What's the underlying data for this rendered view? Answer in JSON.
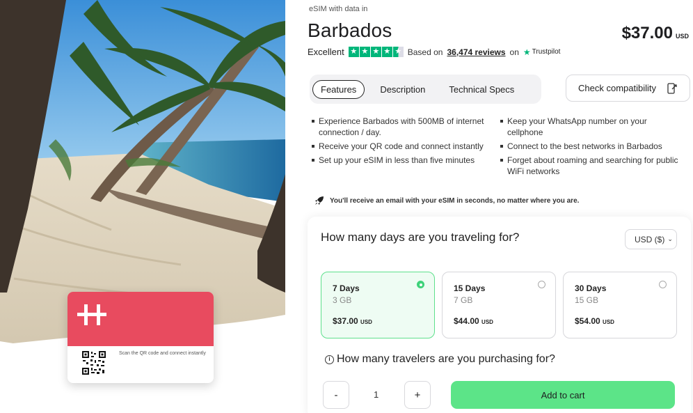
{
  "hero": {
    "card_text": "Scan the QR code and connect instantly"
  },
  "product": {
    "eyebrow": "eSIM with data in",
    "title": "Barbados",
    "price": "$37.00",
    "currency": "USD"
  },
  "rating": {
    "label": "Excellent",
    "stars": 4.5,
    "based_on": "Based on",
    "reviews_link": "36,474 reviews",
    "on": "on",
    "provider": "Trustpilot"
  },
  "tabs": [
    {
      "label": "Features",
      "active": true
    },
    {
      "label": "Description",
      "active": false
    },
    {
      "label": "Technical Specs",
      "active": false
    }
  ],
  "compat_button": "Check compatibility",
  "features": [
    "Experience Barbados with 500MB of internet connection / day.",
    "Keep your WhatsApp number on your cellphone",
    "Receive your QR code and connect instantly",
    "Connect to the best networks in Barbados",
    "Set up your eSIM in less than five minutes",
    "Forget about roaming and searching for public WiFi networks"
  ],
  "notice": "You'll receive an email with your eSIM in seconds, no matter where you are.",
  "panel": {
    "question_days": "How many days are you traveling for?",
    "currency_select": "USD ($)",
    "plans": [
      {
        "days": "7 Days",
        "data": "3 GB",
        "price": "$37.00",
        "currency": "USD",
        "selected": true
      },
      {
        "days": "15 Days",
        "data": "7 GB",
        "price": "$44.00",
        "currency": "USD",
        "selected": false
      },
      {
        "days": "30 Days",
        "data": "15 GB",
        "price": "$54.00",
        "currency": "USD",
        "selected": false
      }
    ],
    "question_travelers": "How many travelers are you purchasing for?",
    "minus": "-",
    "quantity": "1",
    "plus": "+",
    "add_to_cart": "Add to cart"
  },
  "colors": {
    "brand_red": "#e84b5f",
    "accent_green": "#5ce488",
    "trustpilot_green": "#00b67a"
  }
}
